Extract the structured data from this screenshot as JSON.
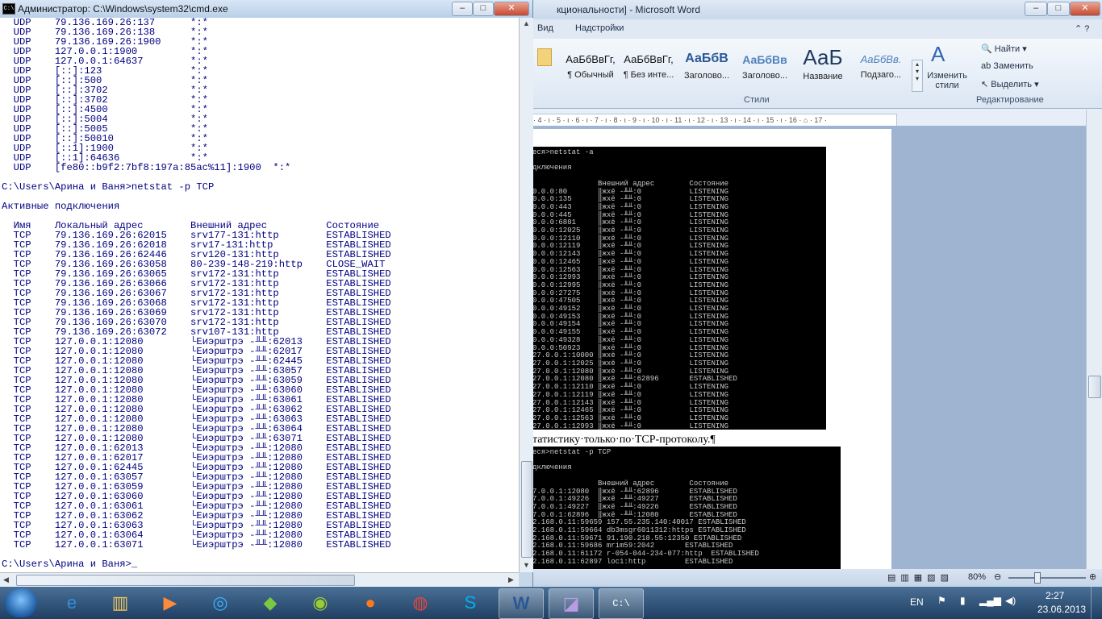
{
  "cmd": {
    "title": "Администратор: C:\\Windows\\system32\\cmd.exe",
    "controls": {
      "min": "‒",
      "max": "□",
      "close": "✕"
    },
    "lines": [
      "  UDP    79.136.169.26:137      *:*",
      "  UDP    79.136.169.26:138      *:*",
      "  UDP    79.136.169.26:1900     *:*",
      "  UDP    127.0.0.1:1900         *:*",
      "  UDP    127.0.0.1:64637        *:*",
      "  UDP    [::]:123               *:*",
      "  UDP    [::]:500               *:*",
      "  UDP    [::]:3702              *:*",
      "  UDP    [::]:3702              *:*",
      "  UDP    [::]:4500              *:*",
      "  UDP    [::]:5004              *:*",
      "  UDP    [::]:5005              *:*",
      "  UDP    [::]:50010             *:*",
      "  UDP    [::1]:1900             *:*",
      "  UDP    [::1]:64636            *:*",
      "  UDP    [fe80::b9f2:7bf8:197a:85ac%11]:1900  *:*",
      "",
      "C:\\Users\\Арина и Ваня>netstat -p TCP",
      "",
      "Активные подключения",
      "",
      "  Имя    Локальный адрес        Внешний адрес          Состояние",
      "  TCP    79.136.169.26:62015    srv177-131:http        ESTABLISHED",
      "  TCP    79.136.169.26:62018    srv17-131:http         ESTABLISHED",
      "  TCP    79.136.169.26:62446    srv120-131:http        ESTABLISHED",
      "  TCP    79.136.169.26:63058    80-239-148-219:http    CLOSE_WAIT",
      "  TCP    79.136.169.26:63065    srv172-131:http        ESTABLISHED",
      "  TCP    79.136.169.26:63066    srv172-131:http        ESTABLISHED",
      "  TCP    79.136.169.26:63067    srv172-131:http        ESTABLISHED",
      "  TCP    79.136.169.26:63068    srv172-131:http        ESTABLISHED",
      "  TCP    79.136.169.26:63069    srv172-131:http        ESTABLISHED",
      "  TCP    79.136.169.26:63070    srv172-131:http        ESTABLISHED",
      "  TCP    79.136.169.26:63072    srv107-131:http        ESTABLISHED",
      "  TCP    127.0.0.1:12080        └Еиэрштрэ -╨╨:62013    ESTABLISHED",
      "  TCP    127.0.0.1:12080        └Еиэрштрэ -╨╨:62017    ESTABLISHED",
      "  TCP    127.0.0.1:12080        └Еиэрштрэ -╨╨:62445    ESTABLISHED",
      "  TCP    127.0.0.1:12080        └Еиэрштрэ -╨╨:63057    ESTABLISHED",
      "  TCP    127.0.0.1:12080        └Еиэрштрэ -╨╨:63059    ESTABLISHED",
      "  TCP    127.0.0.1:12080        └Еиэрштрэ -╨╨:63060    ESTABLISHED",
      "  TCP    127.0.0.1:12080        └Еиэрштрэ -╨╨:63061    ESTABLISHED",
      "  TCP    127.0.0.1:12080        └Еиэрштрэ -╨╨:63062    ESTABLISHED",
      "  TCP    127.0.0.1:12080        └Еиэрштрэ -╨╨:63063    ESTABLISHED",
      "  TCP    127.0.0.1:12080        └Еиэрштрэ -╨╨:63064    ESTABLISHED",
      "  TCP    127.0.0.1:12080        └Еиэрштрэ -╨╨:63071    ESTABLISHED",
      "  TCP    127.0.0.1:62013        └Еиэрштрэ -╨╨:12080    ESTABLISHED",
      "  TCP    127.0.0.1:62017        └Еиэрштрэ -╨╨:12080    ESTABLISHED",
      "  TCP    127.0.0.1:62445        └Еиэрштрэ -╨╨:12080    ESTABLISHED",
      "  TCP    127.0.0.1:63057        └Еиэрштрэ -╨╨:12080    ESTABLISHED",
      "  TCP    127.0.0.1:63059        └Еиэрштрэ -╨╨:12080    ESTABLISHED",
      "  TCP    127.0.0.1:63060        └Еиэрштрэ -╨╨:12080    ESTABLISHED",
      "  TCP    127.0.0.1:63061        └Еиэрштрэ -╨╨:12080    ESTABLISHED",
      "  TCP    127.0.0.1:63062        └Еиэрштрэ -╨╨:12080    ESTABLISHED",
      "  TCP    127.0.0.1:63063        └Еиэрштрэ -╨╨:12080    ESTABLISHED",
      "  TCP    127.0.0.1:63064        └Еиэрштрэ -╨╨:12080    ESTABLISHED",
      "  TCP    127.0.0.1:63071        └Еиэрштрэ -╨╨:12080    ESTABLISHED",
      "",
      "C:\\Users\\Арина и Ваня>"
    ]
  },
  "word": {
    "title": "кциональности] - Microsoft Word",
    "tabs": [
      "Вид",
      "Надстройки"
    ],
    "styles": [
      {
        "sample": "АаБбВвГг,",
        "name": "¶ Обычный"
      },
      {
        "sample": "АаБбВвГг,",
        "name": "¶ Без инте..."
      },
      {
        "sample": "АаБбВ",
        "name": "Заголово..."
      },
      {
        "sample": "АаБбВв",
        "name": "Заголово..."
      },
      {
        "sample": "АаБ",
        "name": "Название"
      },
      {
        "sample": "АаБбВв.",
        "name": "Подзаго..."
      }
    ],
    "change_styles": "Изменить стили",
    "styles_group": "Стили",
    "edit": {
      "find": "Найти",
      "replace": "Заменить",
      "select": "Выделить",
      "group": "Редактирование"
    },
    "ruler": "· 4 · ı · 5 · ı · 6 · ı · 7 · ı · 8 · ı · 9 · ı · 10 · ı · 11 · ı · 12 · ı · 13 · ı · 14 · ı · 15 · ı · 16 · ⌂ · 17 ·",
    "term1": "еся>netstat -a\n\nдключения\n\n               Внешний адрес        Состояние\n0.0.0:80       ‖жхё -╨╨:0           LISTENING\n0.0.0:135      ‖жхё -╨╨:0           LISTENING\n0.0.0:443      ‖жхё -╨╨:0           LISTENING\n0.0.0:445      ‖жхё -╨╨:0           LISTENING\n0.0.0:6881     ‖жхё -╨╨:0           LISTENING\n0.0.0:12025    ‖жхё -╨╨:0           LISTENING\n0.0.0:12110    ‖жхё -╨╨:0           LISTENING\n0.0.0:12119    ‖жхё -╨╨:0           LISTENING\n0.0.0:12143    ‖жхё -╨╨:0           LISTENING\n0.0.0:12465    ‖жхё -╨╨:0           LISTENING\n0.0.0:12563    ‖жхё -╨╨:0           LISTENING\n0.0.0:12993    ‖жхё -╨╨:0           LISTENING\n0.0.0:12995    ‖жхё -╨╨:0           LISTENING\n0.0.0:27275    ‖жхё -╨╨:0           LISTENING\n0.0.0:47505    ‖жхё -╨╨:0           LISTENING\n0.0.0:49152    ‖жхё -╨╨:0           LISTENING\n0.0.0:49153    ‖жхё -╨╨:0           LISTENING\n0.0.0:49154    ‖жхё -╨╨:0           LISTENING\n0.0.0:49155    ‖жхё -╨╨:0           LISTENING\n0.0.0:49328    ‖жхё -╨╨:0           LISTENING\n0.0.0:50923    ‖жхё -╨╨:0           LISTENING\n27.0.0.1:10000 ‖жхё -╨╨:0           LISTENING\n27.0.0.1:12025 ‖жхё -╨╨:0           LISTENING\n27.0.0.1:12080 ‖жхё -╨╨:0           LISTENING\n27.0.0.1:12080 ‖жхё -╨╨:62896       ESTABLISHED\n27.0.0.1:12110 ‖жхё -╨╨:0           LISTENING\n27.0.0.1:12119 ‖жхё -╨╨:0           LISTENING\n27.0.0.1:12143 ‖жхё -╨╨:0           LISTENING\n27.0.0.1:12465 ‖жхё -╨╨:0           LISTENING\n27.0.0.1:12563 ‖жхё -╨╨:0           LISTENING\n27.0.0.1:12993 ‖жхё -╨╨:0           LISTENING",
    "caption": "татистику·только·по·TCP-протоколу.¶",
    "term2": "еся>netstat -p TCP\n\nдключения\n\n               Внешний адрес        Состояние\n7.0.0.1:12080  ‖жхё -╨╨:62896       ESTABLISHED\n7.0.0.1:49226  ‖жхё -╨╨:49227       ESTABLISHED\n7.0.0.1:49227  ‖жхё -╨╨:49226       ESTABLISHED\n7.0.0.1:62896  ‖жхё -╨╨:12080       ESTABLISHED\n2.168.0.11:59659 157.55.235.140:40017 ESTABLISHED\n2.168.0.11:59664 db3msgr6011312:https ESTABLISHED\n2.168.0.11:59671 91.190.218.55:12350 ESTABLISHED\n2.168.0.11:59686 mrim59:2042       ESTABLISHED\n2.168.0.11:61172 r-054-044-234-077:http  ESTABLISHED\n2.168.0.11:62897 loc1:http         ESTABLISHED",
    "zoom": "80%"
  },
  "tray": {
    "lang": "EN",
    "time": "2:27",
    "date": "23.06.2013"
  }
}
